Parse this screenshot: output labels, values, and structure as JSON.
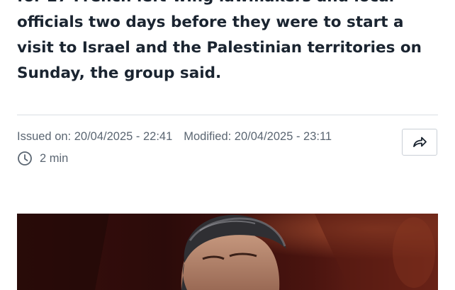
{
  "article": {
    "lede": "for 27 French left-wing lawmakers and local officials two days before they were to start a visit to Israel and the Palestinian territories on Sunday, the group said."
  },
  "meta": {
    "issued": "Issued on: 20/04/2025 - 22:41",
    "modified": "Modified: 20/04/2025 - 23:11",
    "read_time": "2 min"
  },
  "icons": {
    "clock": "clock-icon",
    "share": "share-arrow-icon"
  },
  "colors": {
    "text": "#1a2430",
    "meta": "#5b6672",
    "divider": "#d9dee3"
  }
}
